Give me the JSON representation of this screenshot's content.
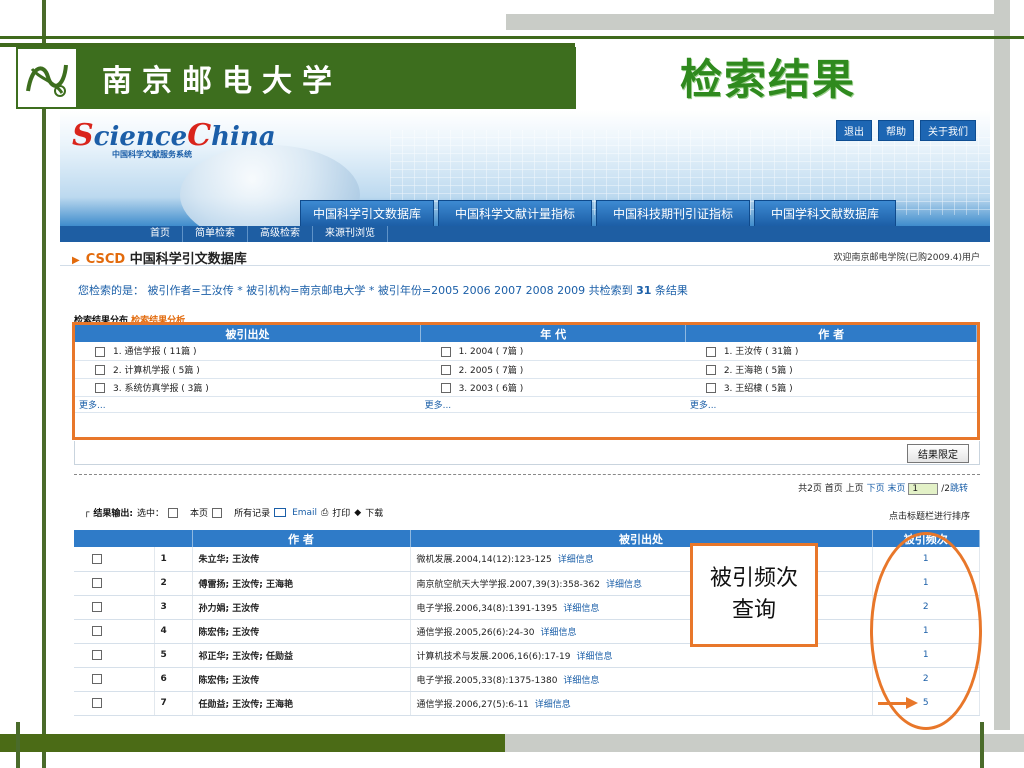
{
  "slide": {
    "university_name": "南京邮电大学",
    "title": "检索结果",
    "callout_line1": "被引频次",
    "callout_line2": "查询"
  },
  "site": {
    "brand_main_s": "S",
    "brand_main_rest": "cience",
    "brand_main_c": "C",
    "brand_main_end": "hina",
    "brand_sub": "中国科学文献服务系统",
    "top_links": [
      "退出",
      "帮助",
      "关于我们"
    ],
    "db_tabs": [
      "中国科学引文数据库",
      "中国科学文献计量指标",
      "中国科技期刊引证指标",
      "中国学科文献数据库"
    ],
    "nav_items": [
      "首页",
      "简单检索",
      "高级检索",
      "来源刊浏览"
    ],
    "db_title_prefix": "CSCD",
    "db_title": "中国科学引文数据库",
    "welcome": "欢迎南京邮电学院(已购2009.4)用户"
  },
  "query": {
    "prefix": "您检索的是：",
    "text": "被引作者=王汝传 * 被引机构=南京邮电大学 * 被引年份=2005 2006 2007 2008 2009 共检索到",
    "count": "31",
    "suffix": "条结果"
  },
  "distribution": {
    "heading": "检索结果分布",
    "link": "检索结果分析",
    "columns": [
      "被引出处",
      "年 代",
      "作 者"
    ],
    "rows": [
      [
        "1. 通信学报 ( 11篇 )",
        "1. 2004 ( 7篇 )",
        "1. 王汝传 ( 31篇 )"
      ],
      [
        "2. 计算机学报 ( 5篇 )",
        "2. 2005 ( 7篇 )",
        "2. 王海艳 ( 5篇 )"
      ],
      [
        "3. 系统仿真学报 ( 3篇 )",
        "3. 2003 ( 6篇 )",
        "3. 王绍棣 ( 5篇 )"
      ]
    ],
    "more": "更多...",
    "limit_button": "结果限定"
  },
  "pager": {
    "summary": "共2页",
    "first": "首页",
    "prev": "上页",
    "next": "下页",
    "last": "末页",
    "page_value": "1",
    "total_suffix": "/2",
    "jump": "跳转"
  },
  "output": {
    "label": "结果输出:",
    "select": "选中：",
    "this_page": "本页",
    "all_records": "所有记录",
    "email": "Email",
    "print": "打印",
    "download": "下载",
    "sort_hint": "点击标题栏进行排序"
  },
  "results": {
    "columns": [
      "作 者",
      "被引出处",
      "被引频次"
    ],
    "detail_label": "详细信息",
    "rows": [
      {
        "idx": "1",
        "authors": "朱立华; 王汝传",
        "source": "微机发展.2004,14(12):123-125",
        "count": "1"
      },
      {
        "idx": "2",
        "authors": "傅雷扬; 王汝传; 王海艳",
        "source": "南京航空航天大学学报.2007,39(3):358-362",
        "count": "1"
      },
      {
        "idx": "3",
        "authors": "孙力娟; 王汝传",
        "source": "电子学报.2006,34(8):1391-1395",
        "count": "2"
      },
      {
        "idx": "4",
        "authors": "陈宏伟; 王汝传",
        "source": "通信学报.2005,26(6):24-30",
        "count": "1"
      },
      {
        "idx": "5",
        "authors": "祁正华; 王汝传; 任勋益",
        "source": "计算机技术与发展.2006,16(6):17-19",
        "count": "1"
      },
      {
        "idx": "6",
        "authors": "陈宏伟; 王汝传",
        "source": "电子学报.2005,33(8):1375-1380",
        "count": "2"
      },
      {
        "idx": "7",
        "authors": "任勋益; 王汝传; 王海艳",
        "source": "通信学报.2006,27(5):6-11",
        "count": "5"
      }
    ]
  },
  "colors": {
    "slide_green": "#3d6e1e",
    "title_green": "#2f8a1e",
    "table_header_blue": "#2f7bc8",
    "annotation_orange": "#e8772a"
  }
}
